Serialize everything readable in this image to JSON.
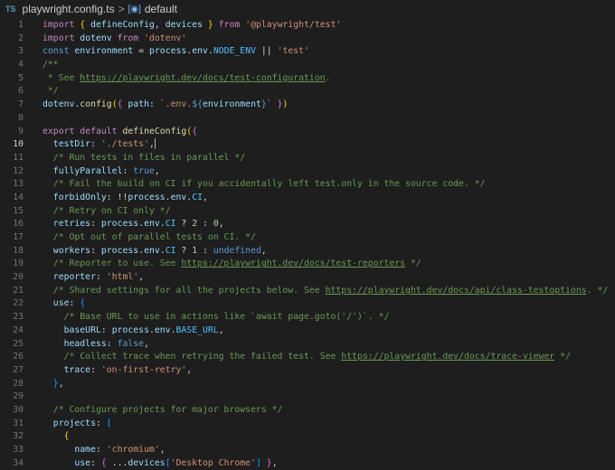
{
  "breadcrumb": {
    "file_badge": "TS",
    "file": "playwright.config.ts",
    "separator": ">",
    "symbol": "default"
  },
  "current_line": 10,
  "lines": [
    {
      "n": "1",
      "t": [
        [
          "kw",
          "import"
        ],
        [
          "p",
          " "
        ],
        [
          "b1",
          "{"
        ],
        [
          "p",
          " "
        ],
        [
          "v",
          "defineConfig"
        ],
        [
          "p",
          ", "
        ],
        [
          "v",
          "devices"
        ],
        [
          "p",
          " "
        ],
        [
          "b1",
          "}"
        ],
        [
          "p",
          " "
        ],
        [
          "kw",
          "from"
        ],
        [
          "p",
          " "
        ],
        [
          "s",
          "'@playwright/test'"
        ]
      ]
    },
    {
      "n": "2",
      "t": [
        [
          "kw",
          "import"
        ],
        [
          "p",
          " "
        ],
        [
          "v",
          "dotenv"
        ],
        [
          "p",
          " "
        ],
        [
          "kw",
          "from"
        ],
        [
          "p",
          " "
        ],
        [
          "s",
          "'dotenv'"
        ]
      ]
    },
    {
      "n": "3",
      "t": [
        [
          "st",
          "const"
        ],
        [
          "p",
          " "
        ],
        [
          "v",
          "environment"
        ],
        [
          "p",
          " = "
        ],
        [
          "v",
          "process"
        ],
        [
          "p",
          "."
        ],
        [
          "v",
          "env"
        ],
        [
          "p",
          "."
        ],
        [
          "c",
          "NODE_ENV"
        ],
        [
          "p",
          " || "
        ],
        [
          "s",
          "'test'"
        ]
      ]
    },
    {
      "n": "4",
      "t": [
        [
          "cm",
          "/**"
        ]
      ]
    },
    {
      "n": "5",
      "t": [
        [
          "cm",
          " * See "
        ],
        [
          "link",
          "https://playwright.dev/docs/test-configuration"
        ],
        [
          "cm",
          "."
        ]
      ]
    },
    {
      "n": "6",
      "t": [
        [
          "cm",
          " */"
        ]
      ]
    },
    {
      "n": "7",
      "t": [
        [
          "v",
          "dotenv"
        ],
        [
          "p",
          "."
        ],
        [
          "fn",
          "config"
        ],
        [
          "b1",
          "("
        ],
        [
          "b2",
          "{"
        ],
        [
          "p",
          " "
        ],
        [
          "v",
          "path"
        ],
        [
          "p",
          ": "
        ],
        [
          "s",
          "`.env."
        ],
        [
          "tp",
          "${"
        ],
        [
          "v",
          "environment"
        ],
        [
          "tp",
          "}"
        ],
        [
          "s",
          "`"
        ],
        [
          "p",
          " "
        ],
        [
          "b2",
          "}"
        ],
        [
          "b1",
          ")"
        ]
      ]
    },
    {
      "n": "8",
      "t": []
    },
    {
      "n": "9",
      "t": [
        [
          "kw",
          "export"
        ],
        [
          "p",
          " "
        ],
        [
          "kw",
          "default"
        ],
        [
          "p",
          " "
        ],
        [
          "fn",
          "defineConfig"
        ],
        [
          "b1",
          "("
        ],
        [
          "b2",
          "{"
        ]
      ]
    },
    {
      "n": "10",
      "t": [
        [
          "p",
          "  "
        ],
        [
          "v",
          "testDir"
        ],
        [
          "p",
          ": "
        ],
        [
          "s",
          "'./tests'"
        ],
        [
          "p",
          ","
        ]
      ]
    },
    {
      "n": "11",
      "t": [
        [
          "p",
          "  "
        ],
        [
          "cm",
          "/* Run tests in files in parallel */"
        ]
      ]
    },
    {
      "n": "12",
      "t": [
        [
          "p",
          "  "
        ],
        [
          "v",
          "fullyParallel"
        ],
        [
          "p",
          ": "
        ],
        [
          "st",
          "true"
        ],
        [
          "p",
          ","
        ]
      ]
    },
    {
      "n": "13",
      "t": [
        [
          "p",
          "  "
        ],
        [
          "cm",
          "/* Fail the build on CI if you accidentally left test.only in the source code. */"
        ]
      ]
    },
    {
      "n": "14",
      "t": [
        [
          "p",
          "  "
        ],
        [
          "v",
          "forbidOnly"
        ],
        [
          "p",
          ": !!"
        ],
        [
          "v",
          "process"
        ],
        [
          "p",
          "."
        ],
        [
          "v",
          "env"
        ],
        [
          "p",
          "."
        ],
        [
          "c",
          "CI"
        ],
        [
          "p",
          ","
        ]
      ]
    },
    {
      "n": "15",
      "t": [
        [
          "p",
          "  "
        ],
        [
          "cm",
          "/* Retry on CI only */"
        ]
      ]
    },
    {
      "n": "16",
      "t": [
        [
          "p",
          "  "
        ],
        [
          "v",
          "retries"
        ],
        [
          "p",
          ": "
        ],
        [
          "v",
          "process"
        ],
        [
          "p",
          "."
        ],
        [
          "v",
          "env"
        ],
        [
          "p",
          "."
        ],
        [
          "c",
          "CI"
        ],
        [
          "p",
          " ? "
        ],
        [
          "n",
          "2"
        ],
        [
          "p",
          " : "
        ],
        [
          "n",
          "0"
        ],
        [
          "p",
          ","
        ]
      ]
    },
    {
      "n": "17",
      "t": [
        [
          "p",
          "  "
        ],
        [
          "cm",
          "/* Opt out of parallel tests on CI. */"
        ]
      ]
    },
    {
      "n": "18",
      "t": [
        [
          "p",
          "  "
        ],
        [
          "v",
          "workers"
        ],
        [
          "p",
          ": "
        ],
        [
          "v",
          "process"
        ],
        [
          "p",
          "."
        ],
        [
          "v",
          "env"
        ],
        [
          "p",
          "."
        ],
        [
          "c",
          "CI"
        ],
        [
          "p",
          " ? "
        ],
        [
          "n",
          "1"
        ],
        [
          "p",
          " : "
        ],
        [
          "st",
          "undefined"
        ],
        [
          "p",
          ","
        ]
      ]
    },
    {
      "n": "19",
      "t": [
        [
          "p",
          "  "
        ],
        [
          "cm",
          "/* Reporter to use. See "
        ],
        [
          "link",
          "https://playwright.dev/docs/test-reporters"
        ],
        [
          "cm",
          " */"
        ]
      ]
    },
    {
      "n": "20",
      "t": [
        [
          "p",
          "  "
        ],
        [
          "v",
          "reporter"
        ],
        [
          "p",
          ": "
        ],
        [
          "s",
          "'html'"
        ],
        [
          "p",
          ","
        ]
      ]
    },
    {
      "n": "21",
      "t": [
        [
          "p",
          "  "
        ],
        [
          "cm",
          "/* Shared settings for all the projects below. See "
        ],
        [
          "link",
          "https://playwright.dev/docs/api/class-testoptions"
        ],
        [
          "cm",
          ". */"
        ]
      ]
    },
    {
      "n": "22",
      "t": [
        [
          "p",
          "  "
        ],
        [
          "v",
          "use"
        ],
        [
          "p",
          ": "
        ],
        [
          "b3",
          "{"
        ]
      ]
    },
    {
      "n": "23",
      "t": [
        [
          "p",
          "    "
        ],
        [
          "cm",
          "/* Base URL to use in actions like `await page.goto('/')`. */"
        ]
      ]
    },
    {
      "n": "24",
      "t": [
        [
          "p",
          "    "
        ],
        [
          "v",
          "baseURL"
        ],
        [
          "p",
          ": "
        ],
        [
          "v",
          "process"
        ],
        [
          "p",
          "."
        ],
        [
          "v",
          "env"
        ],
        [
          "p",
          "."
        ],
        [
          "c",
          "BASE_URL"
        ],
        [
          "p",
          ","
        ]
      ]
    },
    {
      "n": "25",
      "t": [
        [
          "p",
          "    "
        ],
        [
          "v",
          "headless"
        ],
        [
          "p",
          ": "
        ],
        [
          "st",
          "false"
        ],
        [
          "p",
          ","
        ]
      ]
    },
    {
      "n": "26",
      "t": [
        [
          "p",
          "    "
        ],
        [
          "cm",
          "/* Collect trace when retrying the failed test. See "
        ],
        [
          "link",
          "https://playwright.dev/docs/trace-viewer"
        ],
        [
          "cm",
          " */"
        ]
      ]
    },
    {
      "n": "27",
      "t": [
        [
          "p",
          "    "
        ],
        [
          "v",
          "trace"
        ],
        [
          "p",
          ": "
        ],
        [
          "s",
          "'on-first-retry'"
        ],
        [
          "p",
          ","
        ]
      ]
    },
    {
      "n": "28",
      "t": [
        [
          "p",
          "  "
        ],
        [
          "b3",
          "}"
        ],
        [
          "p",
          ","
        ]
      ]
    },
    {
      "n": "29",
      "t": []
    },
    {
      "n": "30",
      "t": [
        [
          "p",
          "  "
        ],
        [
          "cm",
          "/* Configure projects for major browsers */"
        ]
      ]
    },
    {
      "n": "31",
      "t": [
        [
          "p",
          "  "
        ],
        [
          "v",
          "projects"
        ],
        [
          "p",
          ": "
        ],
        [
          "b3",
          "["
        ]
      ]
    },
    {
      "n": "32",
      "t": [
        [
          "p",
          "    "
        ],
        [
          "b1",
          "{"
        ]
      ]
    },
    {
      "n": "33",
      "t": [
        [
          "p",
          "      "
        ],
        [
          "v",
          "name"
        ],
        [
          "p",
          ": "
        ],
        [
          "s",
          "'chromium'"
        ],
        [
          "p",
          ","
        ]
      ]
    },
    {
      "n": "34",
      "t": [
        [
          "p",
          "      "
        ],
        [
          "v",
          "use"
        ],
        [
          "p",
          ": "
        ],
        [
          "b2",
          "{"
        ],
        [
          "p",
          " ..."
        ],
        [
          "v",
          "devices"
        ],
        [
          "b3",
          "["
        ],
        [
          "s",
          "'Desktop Chrome'"
        ],
        [
          "b3",
          "]"
        ],
        [
          "p",
          " "
        ],
        [
          "b2",
          "}"
        ],
        [
          "p",
          ","
        ]
      ]
    }
  ]
}
